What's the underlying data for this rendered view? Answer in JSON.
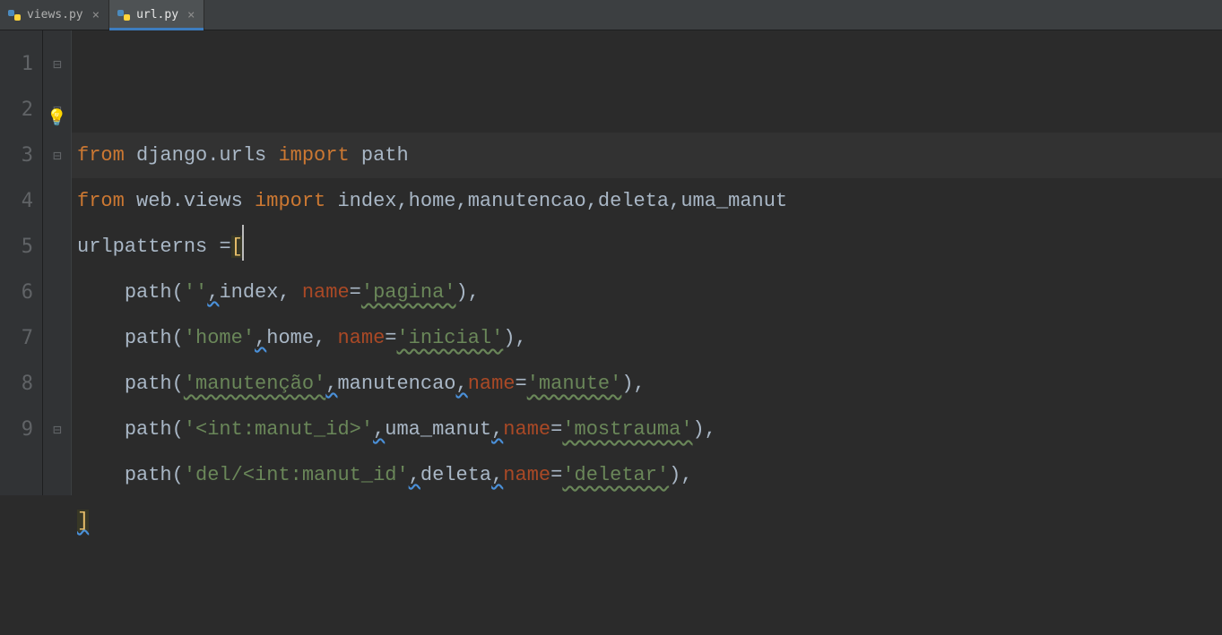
{
  "tabs": [
    {
      "label": "views.py",
      "active": false
    },
    {
      "label": "url.py",
      "active": true
    }
  ],
  "gutter": [
    "1",
    "2",
    "3",
    "4",
    "5",
    "6",
    "7",
    "8",
    "9"
  ],
  "code": {
    "l1": {
      "from": "from",
      "mod": "django.urls",
      "imp": "import",
      "names": "path"
    },
    "l2": {
      "from": "from",
      "mod": "web.views",
      "imp": "import",
      "names": "index,home,manutencao,deleta,uma_manut"
    },
    "l3": {
      "var": "urlpatterns",
      "eq": "=",
      "open": "["
    },
    "l4": {
      "fn": "path",
      "s": "''",
      "arg": "index",
      "kw": "name",
      "val": "'pagina'"
    },
    "l5": {
      "fn": "path",
      "s": "'home'",
      "arg": "home",
      "kw": "name",
      "val": "'inicial'"
    },
    "l6": {
      "fn": "path",
      "s": "'manutenção'",
      "arg": "manutencao",
      "kw": "name",
      "val": "'manute'"
    },
    "l7": {
      "fn": "path",
      "s": "'<int:manut_id>'",
      "arg": "uma_manut",
      "kw": "name",
      "val": "'mostrauma'"
    },
    "l8": {
      "fn": "path",
      "s": "'del/<int:manut_id'",
      "arg": "deleta",
      "kw": "name",
      "val": "'deletar'"
    },
    "l9": {
      "close": "]"
    }
  }
}
